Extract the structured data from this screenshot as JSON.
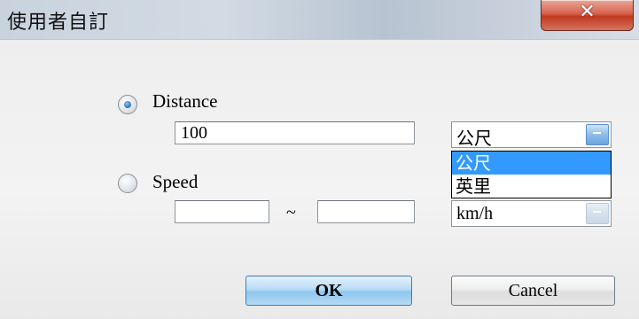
{
  "window": {
    "title": "使用者自訂",
    "close_glyph": "✕"
  },
  "distance": {
    "label": "Distance",
    "selected": true,
    "value": "100",
    "unit_value": "公尺",
    "unit_options": [
      "公尺",
      "英里"
    ],
    "highlighted_option": "公尺"
  },
  "speed": {
    "label": "Speed",
    "selected": false,
    "min_value": "",
    "separator": "~",
    "max_value": "",
    "unit_value": "km/h"
  },
  "buttons": {
    "ok": "OK",
    "cancel": "Cancel"
  },
  "colors": {
    "accent": "#3399ff",
    "close_button": "#c0391f"
  }
}
